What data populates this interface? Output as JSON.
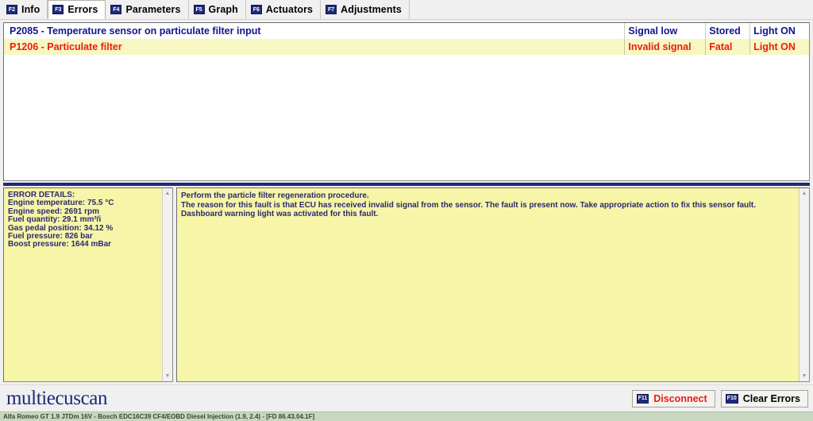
{
  "tabs": [
    {
      "fkey": "F2",
      "label": "Info",
      "active": false
    },
    {
      "fkey": "F3",
      "label": "Errors",
      "active": true
    },
    {
      "fkey": "F4",
      "label": "Parameters",
      "active": false
    },
    {
      "fkey": "F5",
      "label": "Graph",
      "active": false
    },
    {
      "fkey": "F6",
      "label": "Actuators",
      "active": false
    },
    {
      "fkey": "F7",
      "label": "Adjustments",
      "active": false
    }
  ],
  "error_list": {
    "rows": [
      {
        "description": "P2085 - Temperature sensor on particulate filter input",
        "signal": "Signal low",
        "state": "Stored",
        "light": "Light ON",
        "color": "#11158c",
        "selected": false
      },
      {
        "description": "P1206 - Particulate filter",
        "signal": "Invalid signal",
        "state": "Fatal",
        "light": "Light ON",
        "color": "#ee1b0e",
        "selected": true
      }
    ]
  },
  "error_details": {
    "title": "ERROR DETAILS:",
    "lines": [
      "Engine temperature: 75.5 °C",
      "Engine speed: 2691 rpm",
      "Fuel quantity: 29.1 mm³/i",
      "Gas pedal position: 34.12 %",
      "Fuel pressure: 826 bar",
      "Boost pressure: 1644 mBar"
    ]
  },
  "error_description": {
    "lines": [
      "Perform the particle filter regeneration procedure.",
      "The reason for this fault is that ECU has received invalid signal from the sensor. The fault is present now. Take appropriate action to fix this sensor fault. Dashboard warning light was activated for this fault."
    ]
  },
  "footer": {
    "logo": "multiecuscan",
    "buttons": [
      {
        "fkey": "F11",
        "label": "Disconnect",
        "style": "red"
      },
      {
        "fkey": "F10",
        "label": "Clear Errors",
        "style": "black"
      }
    ]
  },
  "statusbar": {
    "text": "Alfa Romeo GT 1.9 JTDm 16V - Bosch EDC16C39 CF4/EOBD Diesel Injection (1.9, 2.4) - [FD 86.43.04.1F]"
  },
  "icons": {
    "scroll_up": "▲",
    "scroll_down": "▼"
  },
  "colors": {
    "navy": "#11158c",
    "red": "#ee1b0e",
    "badge": "#1d2a7a",
    "highlight": "#f7f7c2",
    "pane": "#f6f5a8",
    "status_bg": "#c8d8c0"
  }
}
